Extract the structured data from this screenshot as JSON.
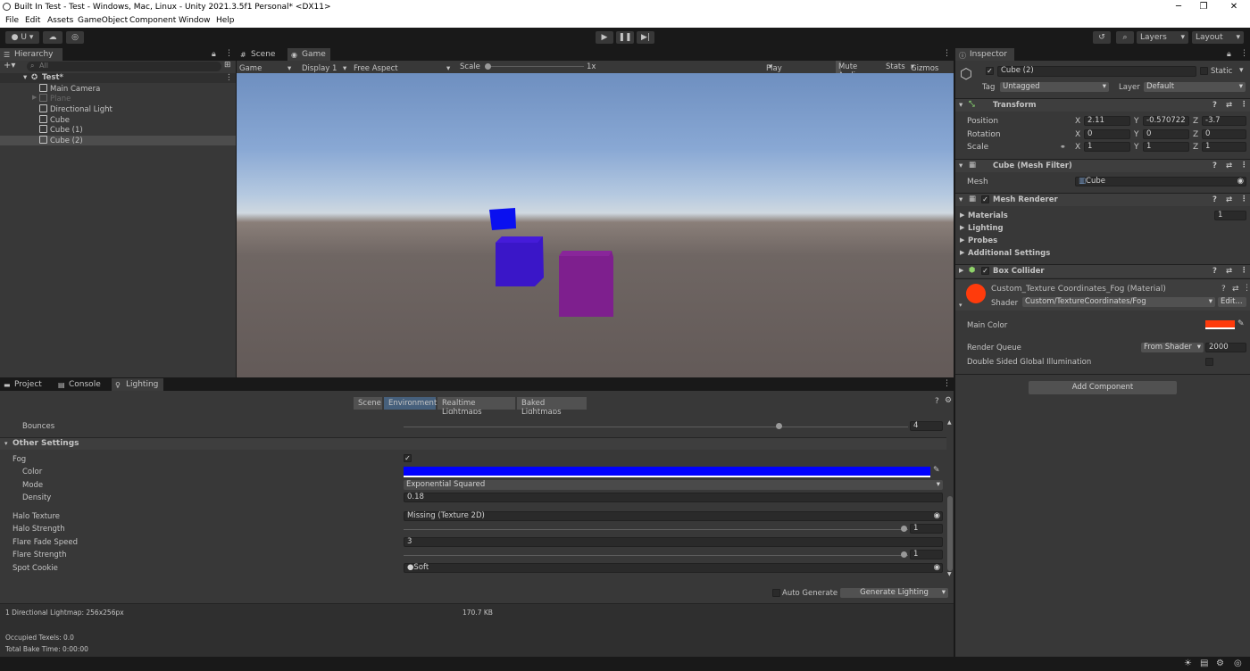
{
  "window": {
    "title": "Built In Test - Test - Windows, Mac, Linux - Unity 2021.3.5f1 Personal* <DX11>",
    "minimize": "─",
    "maximize": "❐",
    "close": "✕"
  },
  "menu": [
    "File",
    "Edit",
    "Assets",
    "GameObject",
    "Component",
    "Window",
    "Help"
  ],
  "toolbar": {
    "account": "U",
    "layers": "Layers",
    "layout": "Layout"
  },
  "hierarchy": {
    "tab": "Hierarchy",
    "search_placeholder": "All",
    "scene": "Test*",
    "items": [
      "Main Camera",
      "Plane",
      "Directional Light",
      "Cube",
      "Cube (1)",
      "Cube (2)"
    ]
  },
  "view_tabs": {
    "scene": "Scene",
    "game": "Game"
  },
  "game_options": {
    "mode": "Game",
    "display": "Display 1",
    "aspect": "Free Aspect",
    "scale_label": "Scale",
    "scale_value": "1x",
    "play_focused": "Play Focused",
    "mute_audio": "Mute Audio",
    "stats": "Stats",
    "gizmos": "Gizmos"
  },
  "inspector": {
    "tab": "Inspector",
    "object_name": "Cube (2)",
    "static_label": "Static",
    "tag_label": "Tag",
    "tag_value": "Untagged",
    "layer_label": "Layer",
    "layer_value": "Default",
    "transform": {
      "title": "Transform",
      "position_label": "Position",
      "rotation_label": "Rotation",
      "scale_label": "Scale",
      "position": {
        "x": "2.11",
        "y": "-0.570722",
        "z": "-3.7"
      },
      "rotation": {
        "x": "0",
        "y": "0",
        "z": "0"
      },
      "scale": {
        "x": "1",
        "y": "1",
        "z": "1"
      }
    },
    "mesh_filter": {
      "title": "Cube (Mesh Filter)",
      "mesh_label": "Mesh",
      "mesh_value": "Cube"
    },
    "mesh_renderer": {
      "title": "Mesh Renderer",
      "materials": "Materials",
      "materials_count": "1",
      "lighting": "Lighting",
      "probes": "Probes",
      "additional": "Additional Settings"
    },
    "box_collider": {
      "title": "Box Collider"
    },
    "material": {
      "title": "Custom_Texture Coordinates_Fog (Material)",
      "shader_label": "Shader",
      "shader_value": "Custom/TextureCoordinates/Fog",
      "edit": "Edit...",
      "main_color_label": "Main Color",
      "main_color": "#ff3b0c",
      "render_queue_label": "Render Queue",
      "render_queue_mode": "From Shader",
      "render_queue_value": "2000",
      "double_sided_label": "Double Sided Global Illumination"
    },
    "add_component": "Add Component"
  },
  "bottom_tabs": {
    "project": "Project",
    "console": "Console",
    "lighting": "Lighting"
  },
  "lighting": {
    "segments": [
      "Scene",
      "Environment",
      "Realtime Lightmaps",
      "Baked Lightmaps"
    ],
    "bounces_label": "Bounces",
    "bounces_value": "4",
    "other_settings": "Other Settings",
    "fog_label": "Fog",
    "fog_check": "✓",
    "color_label": "Color",
    "fog_color": "#0000ff",
    "mode_label": "Mode",
    "mode_value": "Exponential Squared",
    "density_label": "Density",
    "density_value": "0.18",
    "halo_texture_label": "Halo Texture",
    "halo_texture_value": "Missing (Texture 2D)",
    "halo_strength_label": "Halo Strength",
    "halo_strength_value": "1",
    "flare_fade_label": "Flare Fade Speed",
    "flare_fade_value": "3",
    "flare_strength_label": "Flare Strength",
    "flare_strength_value": "1",
    "spot_cookie_label": "Spot Cookie",
    "spot_cookie_value": "Soft",
    "auto_generate": "Auto Generate",
    "generate": "Generate Lighting",
    "lightmap_info": "1 Directional Lightmap: 256x256px",
    "lightmap_size": "170.7 KB",
    "occupied": "Occupied Texels: 0.0",
    "bake_time": "Total Bake Time: 0:00:00"
  },
  "scene_objects": {
    "cube_small_color": "#0a10f0",
    "cube_mid_color": "#3a16c8",
    "cube_right_color": "#7e1f8e"
  }
}
